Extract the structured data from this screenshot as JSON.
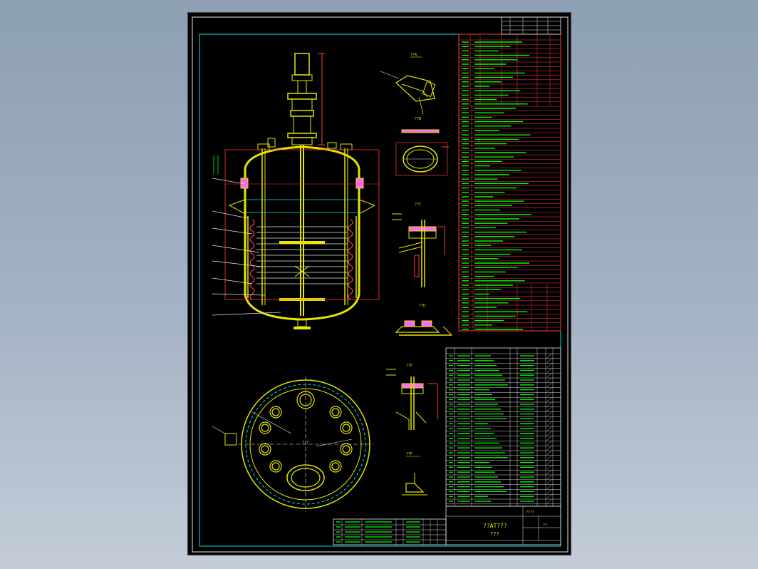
{
  "drawing": {
    "title_block": {
      "name_line": "??AT???",
      "sub_line": "???",
      "scale_label": "????",
      "sheet_label": "??"
    },
    "colors": {
      "frame": "#00ffff",
      "table_grid": "#ff0000",
      "text": "#ffff00",
      "vessel": "#ffff00",
      "coil": "#ff3b3b",
      "dimension": "#00ff00",
      "background": "#000000"
    },
    "section_labels": {
      "detail_a": "??A",
      "detail_b": "??B",
      "detail_c": "??C",
      "detail_d": "??D",
      "detail_e": "??E",
      "plan_view": "?-?",
      "detail_f": "??F"
    }
  }
}
